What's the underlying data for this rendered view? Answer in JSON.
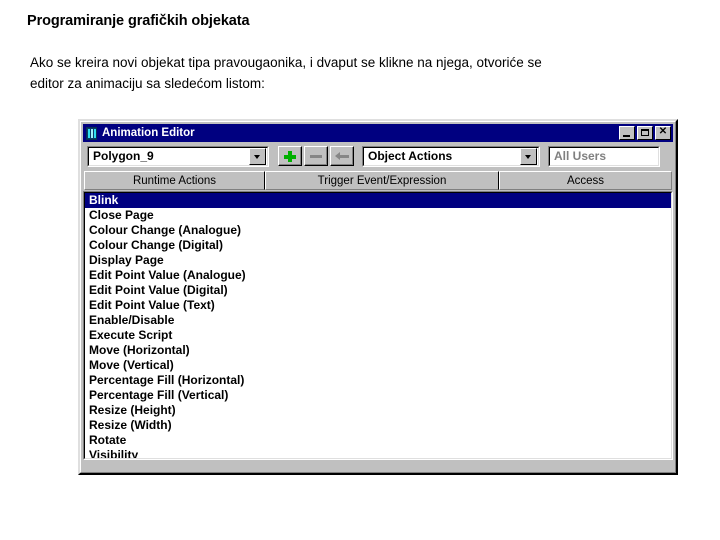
{
  "slide": {
    "heading": "Programiranje grafičkih objekata",
    "paragraph_line1": "Ako se kreira novi objekat tipa pravougaonika, i dvaput se klikne na njega, otvoriće se",
    "paragraph_line2": "editor za animaciju sa sledećom listom:"
  },
  "window": {
    "title": "Animation Editor",
    "icon": "animation-editor-icon",
    "controls": {
      "minimize": "_",
      "maximize": "□",
      "close": "✕"
    },
    "toolbar": {
      "object_combo": {
        "value": "Polygon_9",
        "arrow": "chevron-down-icon"
      },
      "add_button": "+",
      "remove_button": "−",
      "back_button": "←",
      "actions_combo": {
        "value": "Object Actions",
        "arrow": "chevron-down-icon"
      },
      "users_field": {
        "value": "All Users"
      }
    },
    "columns": [
      {
        "label": "Runtime Actions"
      },
      {
        "label": "Trigger Event/Expression"
      },
      {
        "label": "Access"
      }
    ],
    "list": {
      "selected_index": 0,
      "items": [
        "Blink",
        "Close Page",
        "Colour Change (Analogue)",
        "Colour Change (Digital)",
        "Display Page",
        "Edit Point Value (Analogue)",
        "Edit Point Value (Digital)",
        "Edit Point Value (Text)",
        "Enable/Disable",
        "Execute Script",
        "Move (Horizontal)",
        "Move (Vertical)",
        "Percentage Fill (Horizontal)",
        "Percentage Fill (Vertical)",
        "Resize (Height)",
        "Resize (Width)",
        "Rotate",
        "Visibility"
      ]
    }
  },
  "colors": {
    "titlebar": "#000080",
    "selection": "#000080",
    "window_face": "#c0c0c0",
    "add_icon": "#00b000",
    "disabled_text": "#808080"
  }
}
